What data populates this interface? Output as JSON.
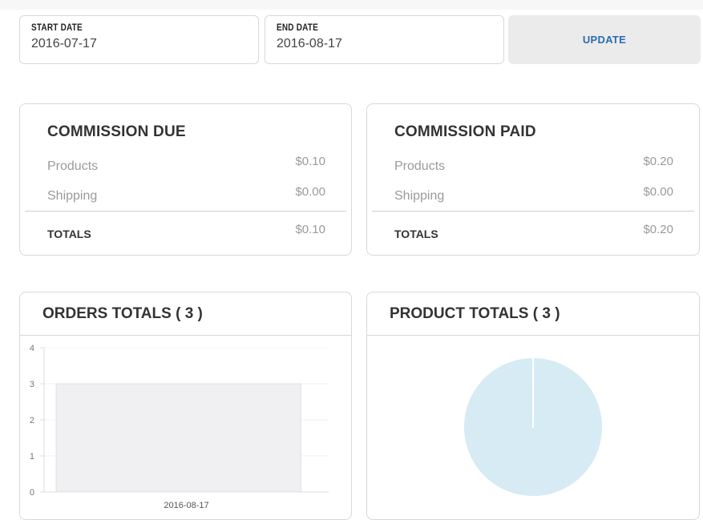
{
  "filters": {
    "start_date": {
      "label": "START DATE",
      "value": "2016-07-17"
    },
    "end_date": {
      "label": "END DATE",
      "value": "2016-08-17"
    },
    "update_label": "UPDATE"
  },
  "commission_due": {
    "title": "COMMISSION DUE",
    "products_label": "Products",
    "products_value": "$0.10",
    "shipping_label": "Shipping",
    "shipping_value": "$0.00",
    "totals_label": "TOTALS",
    "totals_value": "$0.10"
  },
  "commission_paid": {
    "title": "COMMISSION PAID",
    "products_label": "Products",
    "products_value": "$0.20",
    "shipping_label": "Shipping",
    "shipping_value": "$0.00",
    "totals_label": "TOTALS",
    "totals_value": "$0.20"
  },
  "orders_panel": {
    "title": "ORDERS TOTALS ( 3 )"
  },
  "products_panel": {
    "title": "PRODUCT TOTALS ( 3 )"
  },
  "colors": {
    "accent": "#2b6cb0",
    "bar_fill": "#f0f0f2",
    "pie_fill": "#d6ebf3"
  },
  "chart_data": [
    {
      "type": "bar",
      "categories": [
        "2016-08-17"
      ],
      "values": [
        3
      ],
      "y_ticks": [
        "0",
        "1",
        "2",
        "3",
        "4"
      ],
      "ylim": [
        0,
        4
      ],
      "grid": true
    },
    {
      "type": "pie",
      "slices": [
        {
          "value": 1
        },
        {
          "value": 2999
        }
      ]
    }
  ]
}
